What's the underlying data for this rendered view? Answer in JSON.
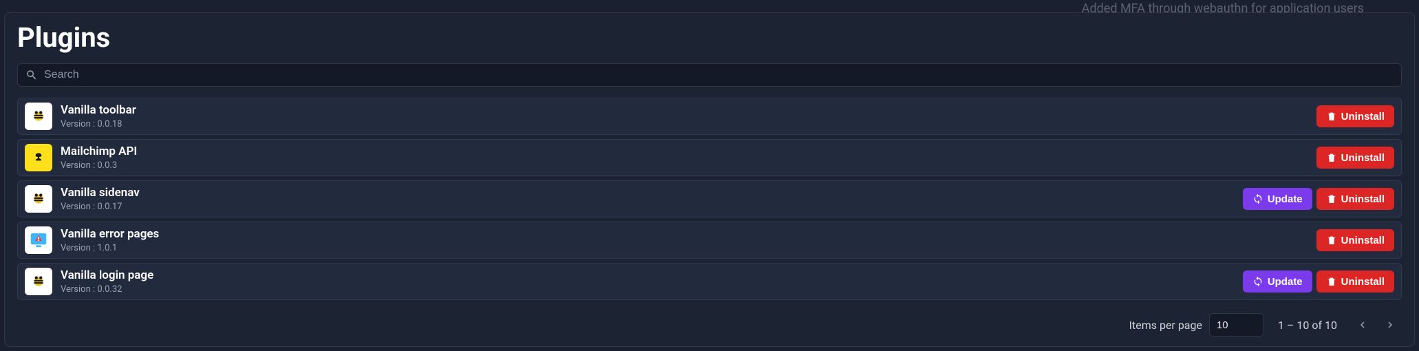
{
  "background": {
    "line1": "Added MFA through webauthn for application users"
  },
  "panel": {
    "title": "Plugins",
    "search_placeholder": "Search",
    "buttons": {
      "update": "Update",
      "uninstall": "Uninstall"
    },
    "plugins": [
      {
        "name": "Vanilla toolbar",
        "version_label": "Version : 0.0.18",
        "icon": "vanilla",
        "update": false
      },
      {
        "name": "Mailchimp API",
        "version_label": "Version : 0.0.3",
        "icon": "mailchimp",
        "update": false
      },
      {
        "name": "Vanilla sidenav",
        "version_label": "Version : 0.0.17",
        "icon": "vanilla",
        "update": true
      },
      {
        "name": "Vanilla error pages",
        "version_label": "Version : 1.0.1",
        "icon": "error",
        "update": false
      },
      {
        "name": "Vanilla login page",
        "version_label": "Version : 0.0.32",
        "icon": "vanilla",
        "update": true
      }
    ],
    "footer": {
      "items_per_page_label": "Items per page",
      "items_per_page_value": "10",
      "range_label": "1 – 10 of 10"
    }
  },
  "colors": {
    "accent_update": "#7c3aed",
    "accent_uninstall": "#dc2626",
    "panel_bg": "#1c2333",
    "row_bg": "#222a3d"
  }
}
